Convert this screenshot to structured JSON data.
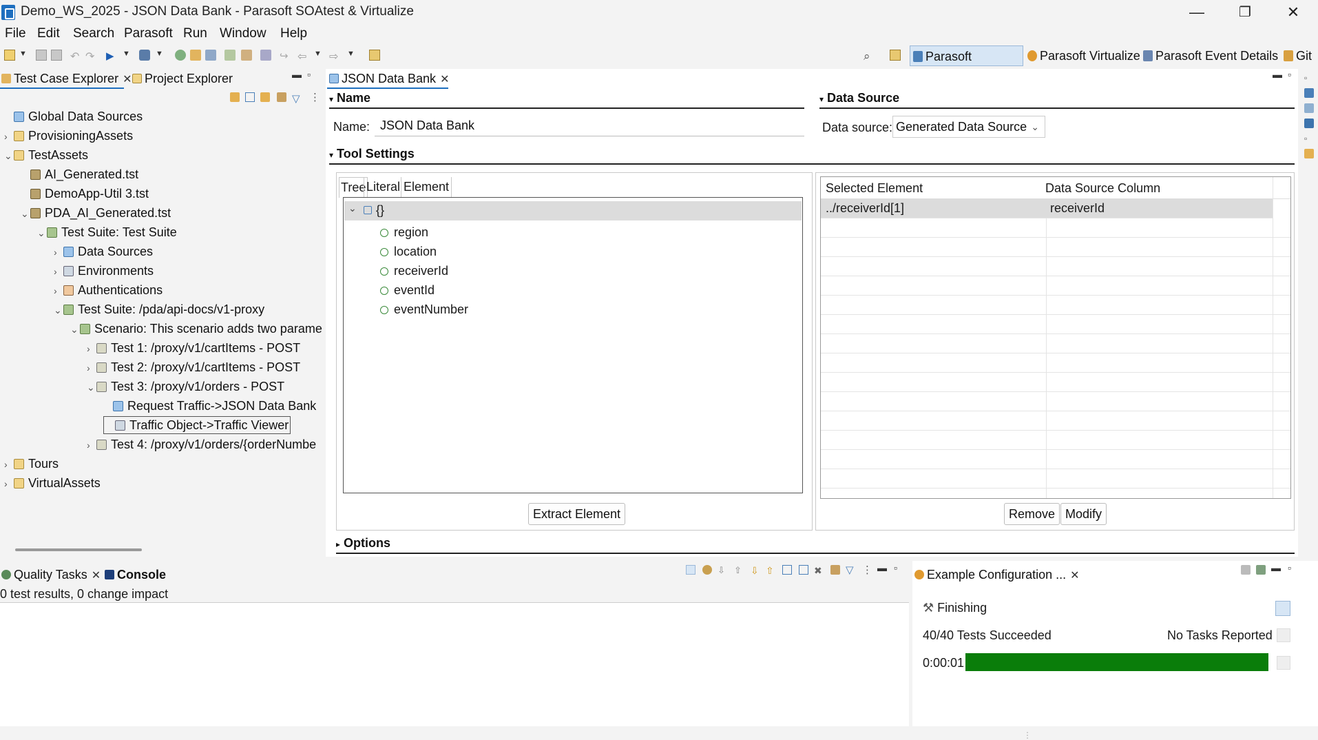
{
  "window": {
    "title": "Demo_WS_2025 - JSON Data Bank - Parasoft SOAtest & Virtualize",
    "minimize": "—",
    "maximize": "❐",
    "close": "✕"
  },
  "menu": [
    "File",
    "Edit",
    "Search",
    "Parasoft",
    "Run",
    "Window",
    "Help"
  ],
  "perspectives": {
    "soatest": "Parasoft SOAtest",
    "virtualize": "Parasoft Virtualize",
    "event_details": "Parasoft Event Details",
    "git": "Git"
  },
  "left_panel": {
    "tabs": [
      "Test Case Explorer",
      "Project Explorer"
    ],
    "tree": [
      {
        "label": "Global Data Sources",
        "icon": "db-icon",
        "indent": 0,
        "twisty": ""
      },
      {
        "label": "ProvisioningAssets",
        "icon": "folder-icon",
        "indent": 0,
        "twisty": "›"
      },
      {
        "label": "TestAssets",
        "icon": "folder-icon",
        "indent": 0,
        "twisty": "⌄"
      },
      {
        "label": "AI_Generated.tst",
        "icon": "tst-icon",
        "indent": 1,
        "twisty": ""
      },
      {
        "label": "DemoApp-Util 3.tst",
        "icon": "tst-icon",
        "indent": 1,
        "twisty": ""
      },
      {
        "label": "PDA_AI_Generated.tst",
        "icon": "tst-icon",
        "indent": 1,
        "twisty": "⌄"
      },
      {
        "label": "Test Suite: Test Suite",
        "icon": "suite-icon",
        "indent": 2,
        "twisty": "⌄"
      },
      {
        "label": "Data Sources",
        "icon": "db-icon",
        "indent": 3,
        "twisty": "›"
      },
      {
        "label": "Environments",
        "icon": "gear-icon",
        "indent": 3,
        "twisty": "›"
      },
      {
        "label": "Authentications",
        "icon": "user-icon",
        "indent": 3,
        "twisty": "›"
      },
      {
        "label": "Test Suite: /pda/api-docs/v1-proxy",
        "icon": "suite-icon",
        "indent": 3,
        "twisty": "⌄"
      },
      {
        "label": "Scenario: This scenario adds two paramet",
        "icon": "suite-icon",
        "indent": 4,
        "twisty": "⌄"
      },
      {
        "label": "Test 1: /proxy/v1/cartItems - POST",
        "icon": "test-icon",
        "indent": 5,
        "twisty": "›"
      },
      {
        "label": "Test 2: /proxy/v1/cartItems - POST",
        "icon": "test-icon",
        "indent": 5,
        "twisty": "›"
      },
      {
        "label": "Test 3: /proxy/v1/orders - POST",
        "icon": "test-icon",
        "indent": 5,
        "twisty": "⌄"
      },
      {
        "label": "Request Traffic->JSON Data Bank",
        "icon": "db-icon",
        "indent": 6,
        "twisty": ""
      },
      {
        "label": "Traffic Object->Traffic Viewer",
        "icon": "gear-icon",
        "indent": 6,
        "twisty": "",
        "selected": true
      },
      {
        "label": "Test 4: /proxy/v1/orders/{orderNumbe",
        "icon": "test-icon",
        "indent": 5,
        "twisty": "›"
      },
      {
        "label": "Tours",
        "icon": "folder-icon",
        "indent": 0,
        "twisty": "›"
      },
      {
        "label": "VirtualAssets",
        "icon": "folder-icon",
        "indent": 0,
        "twisty": "›"
      }
    ]
  },
  "editor": {
    "tab": "JSON Data Bank",
    "name_section": "Name",
    "name_label": "Name:",
    "name_value": "JSON Data Bank",
    "data_source_section": "Data Source",
    "data_source_label": "Data source:",
    "data_source_value": "Generated Data Source",
    "tool_settings": "Tool Settings",
    "view_tabs": [
      "Tree",
      "Literal",
      "Element"
    ],
    "tree_root": "{}",
    "tree_fields": [
      "region",
      "location",
      "receiverId",
      "eventId",
      "eventNumber"
    ],
    "table_headers": [
      "Selected Element",
      "Data Source Column"
    ],
    "table_rows": [
      {
        "element": "../receiverId[1]",
        "column": "receiverId"
      }
    ],
    "extract_button": "Extract Element",
    "remove_button": "Remove",
    "modify_button": "Modify",
    "options_section": "Options"
  },
  "bottom_left": {
    "tabs": [
      "Quality Tasks",
      "Console"
    ],
    "status": "0 test results, 0 change impact"
  },
  "bottom_right": {
    "tab": "Example Configuration ...",
    "state": "Finishing",
    "result": "40/40 Tests Succeeded",
    "tasks": "No Tasks Reported",
    "elapsed": "0:00:01",
    "progress": 1.0,
    "progress_color": "#0a7d0a"
  }
}
